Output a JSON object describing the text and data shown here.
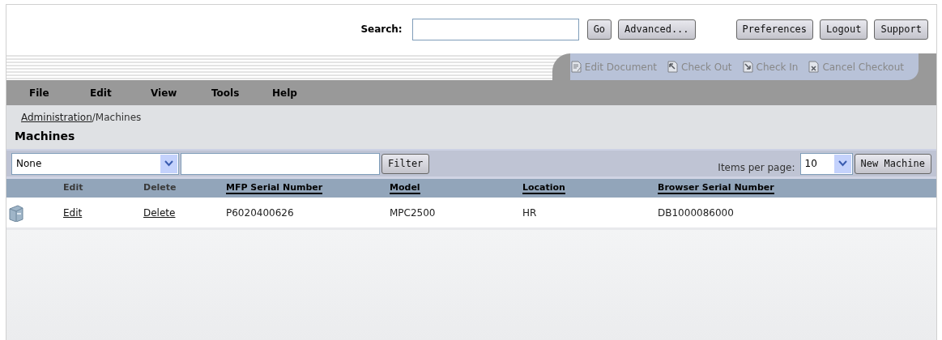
{
  "search": {
    "label": "Search:",
    "buttons": [
      "Go",
      "Advanced..."
    ]
  },
  "top_buttons": [
    "Preferences",
    "Logout",
    "Support"
  ],
  "toolbar": [
    {
      "label": "Edit Document",
      "disabled": true
    },
    {
      "label": "Check Out",
      "disabled": true
    },
    {
      "label": "Check In",
      "disabled": true
    },
    {
      "label": "Cancel Checkout",
      "disabled": true
    }
  ],
  "menu": [
    "File",
    "Edit",
    "View",
    "Tools",
    "Help"
  ],
  "breadcrumb": {
    "link": "Administration",
    "separator": "/",
    "current": "Machines"
  },
  "title": "Machines",
  "filter": {
    "field": "None",
    "button": "Filter",
    "items_label": "Items per page:",
    "items_value": "10",
    "new_button": "New Machine"
  },
  "table": {
    "columns": [
      {
        "label": "Edit",
        "link": false
      },
      {
        "label": "Delete",
        "link": false
      },
      {
        "label": "MFP Serial Number",
        "link": true
      },
      {
        "label": "Model",
        "link": true
      },
      {
        "label": "Location",
        "link": true
      },
      {
        "label": "Browser Serial Number",
        "link": true
      }
    ],
    "rows": [
      {
        "edit": "Edit",
        "delete": "Delete",
        "mfp_serial": "P6020400626",
        "model": "MPC2500",
        "location": "HR",
        "browser_serial": "DB1000086000"
      }
    ]
  }
}
